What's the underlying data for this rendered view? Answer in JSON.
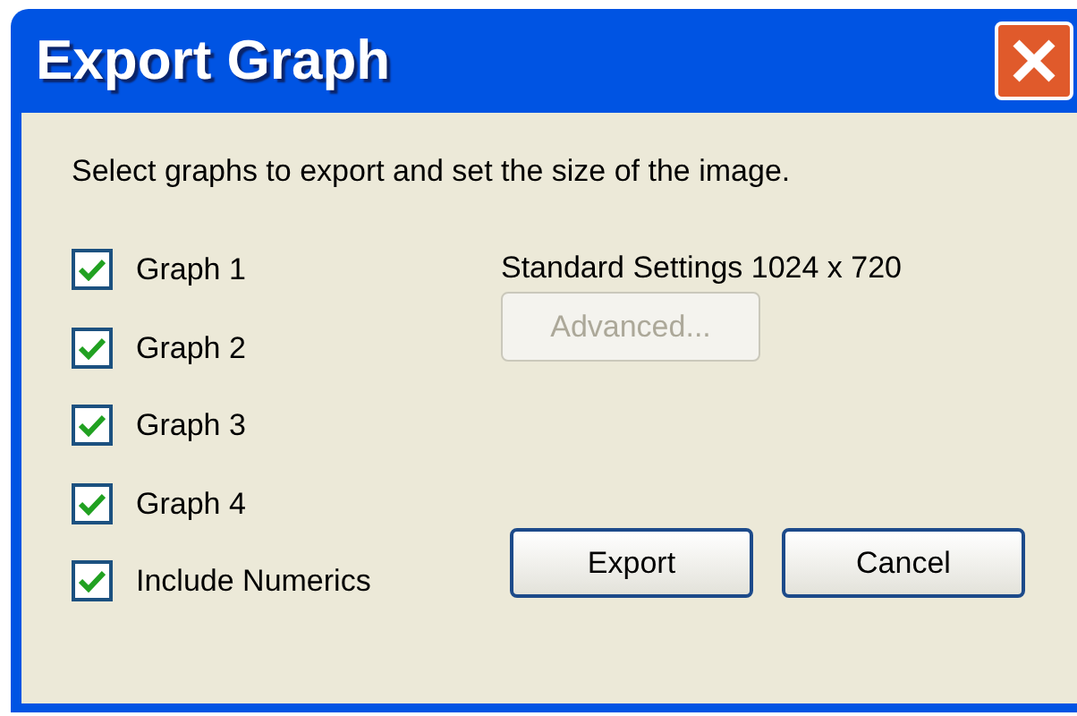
{
  "window": {
    "title": "Export Graph"
  },
  "instructions": "Select graphs to export and set the size of the image.",
  "checkboxes": [
    {
      "label": "Graph 1",
      "checked": true
    },
    {
      "label": "Graph 2",
      "checked": true
    },
    {
      "label": "Graph 3",
      "checked": true
    },
    {
      "label": "Graph 4",
      "checked": true
    },
    {
      "label": "Include Numerics",
      "checked": true
    }
  ],
  "settings_label": "Standard Settings 1024 x 720",
  "advanced_button": {
    "label": "Advanced...",
    "disabled": true
  },
  "buttons": [
    "Export",
    "Cancel"
  ]
}
